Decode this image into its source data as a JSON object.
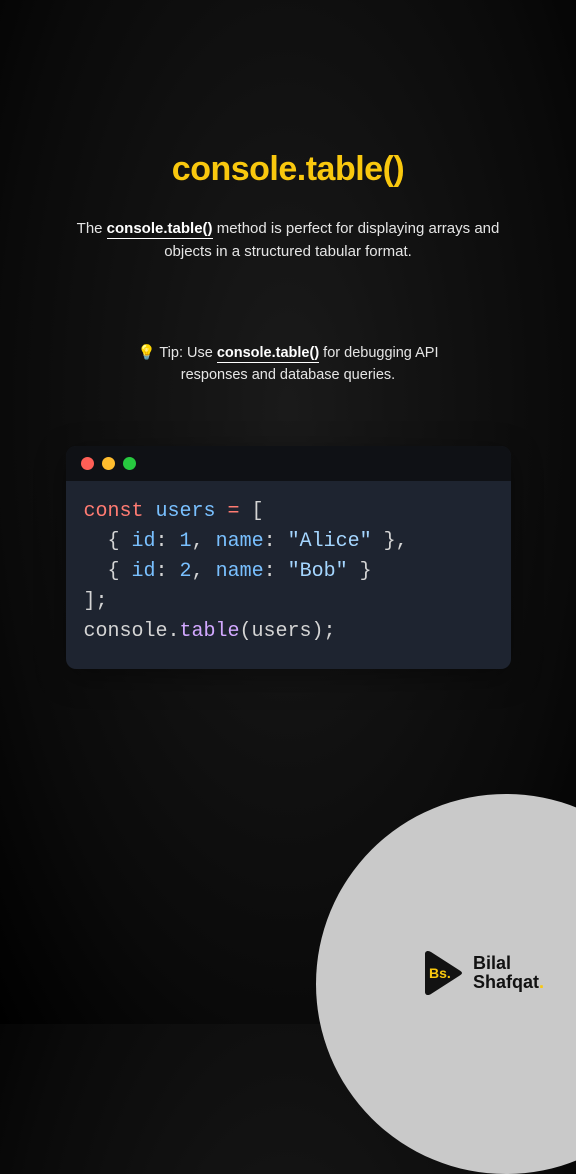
{
  "title": "console.table()",
  "description": {
    "pre": "The ",
    "emph": "console.table()",
    "post": " method is perfect for displaying arrays and objects in a structured tabular format."
  },
  "tip": {
    "icon": "💡",
    "pre": " Tip: Use ",
    "emph": "console.table()",
    "post": " for debugging API responses and database queries."
  },
  "code": {
    "line1_kw": "const",
    "line1_var": " users ",
    "line1_eq": "=",
    "line1_open": " [",
    "line2_open": "  { ",
    "line2_id_key": "id",
    "line2_colon1": ": ",
    "line2_id_val": "1",
    "line2_comma1": ", ",
    "line2_name_key": "name",
    "line2_colon2": ": ",
    "line2_name_val": "\"Alice\"",
    "line2_close": " },",
    "line3_open": "  { ",
    "line3_id_key": "id",
    "line3_colon1": ": ",
    "line3_id_val": "2",
    "line3_comma1": ", ",
    "line3_name_key": "name",
    "line3_colon2": ": ",
    "line3_name_val": "\"Bob\"",
    "line3_close": " }",
    "line4": "];",
    "line5_obj": "console",
    "line5_dot": ".",
    "line5_fn": "table",
    "line5_call": "(users);"
  },
  "logo": {
    "badge": "Bs.",
    "line1": "Bilal",
    "line2": "Shafqat",
    "period": "."
  }
}
